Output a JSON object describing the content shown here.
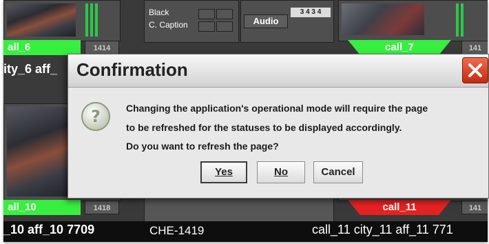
{
  "background": {
    "tiles": {
      "tile_6_label": "all_6",
      "tile_6_num": "1414",
      "tile_7_label": "call_7",
      "tile_7_num": "141",
      "tile_10_label": "all_10",
      "tile_10_num": "1418",
      "tile_11_label": "call_11",
      "tile_11_num": "141"
    },
    "captions": {
      "caption_6": "ity_6 aff_",
      "caption_10": "_10 aff_10 7709",
      "caption_che": "CHE-1419",
      "caption_11": "call_11 city_11 aff_11 771"
    },
    "switches": {
      "black_label": "Black",
      "caption_label": "C. Caption"
    },
    "audio": {
      "label": "Audio",
      "channels": "3 4 3 4"
    }
  },
  "dialog": {
    "title": "Confirmation",
    "icon": "question-icon",
    "message_line1": "Changing the application's operational mode will require the page",
    "message_line2": "to be refreshed for the statuses to be displayed accordingly.",
    "message_line3": "Do you want to refresh the page?",
    "buttons": {
      "yes": "Yes",
      "no": "No",
      "cancel": "Cancel"
    }
  },
  "colors": {
    "status_green": "#37ef3f",
    "status_red": "#e52222",
    "close_red": "#d9411f"
  }
}
